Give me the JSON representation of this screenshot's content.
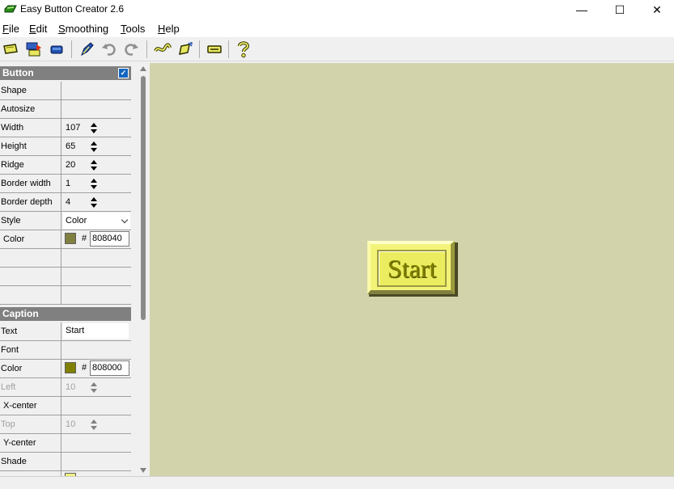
{
  "window": {
    "title": "Easy Button Creator 2.6",
    "minimize_glyph": "—",
    "maximize_glyph": "☐",
    "close_glyph": "✕"
  },
  "menu": {
    "items": [
      {
        "accel": "F",
        "rest": "ile"
      },
      {
        "accel": "E",
        "rest": "dit"
      },
      {
        "accel": "S",
        "rest": "moothing"
      },
      {
        "accel": "T",
        "rest": "ools"
      },
      {
        "accel": "H",
        "rest": "elp"
      }
    ]
  },
  "toolbar": {
    "icons": [
      "new-button-icon",
      "export-icon",
      "button-preview-icon",
      "edit-pen-icon",
      "undo-icon",
      "redo-icon",
      "smoothing-icon",
      "transform-icon",
      "caption-bar-icon",
      "help-icon"
    ]
  },
  "button_section": {
    "title": "Button",
    "shape_label": "Shape",
    "autosize_label": "Autosize",
    "width_label": "Width",
    "width_value": "107",
    "height_label": "Height",
    "height_value": "65",
    "ridge_label": "Ridge",
    "ridge_value": "20",
    "border_width_label": "Border width",
    "border_width_value": "1",
    "border_depth_label": "Border depth",
    "border_depth_value": "4",
    "style_label": "Style",
    "style_value": "Color",
    "color_label": "Color",
    "color_hash": "#",
    "color_hex": "808040"
  },
  "caption_section": {
    "title": "Caption",
    "text_label": "Text",
    "text_value": "Start",
    "font_label": "Font",
    "color_label": "Color",
    "color_hash": "#",
    "color_hex": "808000",
    "left_label": "Left",
    "left_value": "10",
    "xcenter_label": "X-center",
    "top_label": "Top",
    "top_value": "10",
    "ycenter_label": "Y-center",
    "shade_label": "Shade"
  },
  "preview": {
    "caption": "Start"
  },
  "colors": {
    "canvas_bg": "#d3d3ab",
    "button_color": "#808040",
    "caption_color": "#808000",
    "button_face": "#f3f37a"
  }
}
